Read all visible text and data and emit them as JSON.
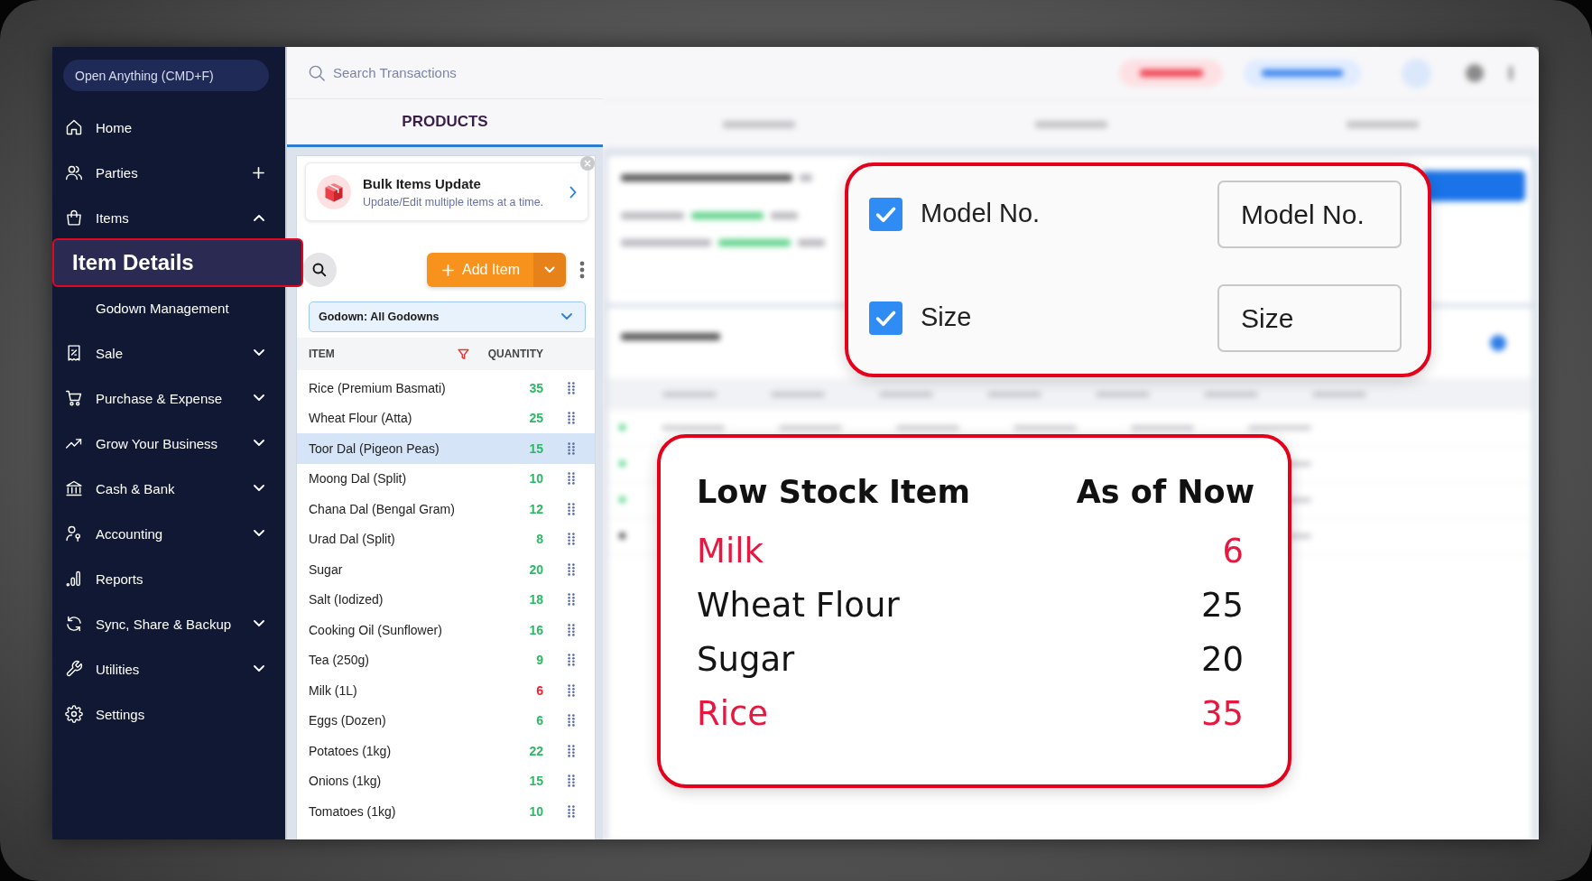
{
  "sidebar": {
    "search": {
      "placeholder": "Open Anything (CMD+F)"
    },
    "items": [
      {
        "kind": "link",
        "label": "Home"
      },
      {
        "kind": "add",
        "label": "Parties"
      },
      {
        "kind": "group",
        "label": "Items",
        "expanded": true,
        "children": [
          {
            "label": "Item Details",
            "selected": true
          },
          {
            "label": "Godown Management",
            "selected": false
          }
        ]
      },
      {
        "kind": "group",
        "label": "Sale",
        "expanded": false
      },
      {
        "kind": "group",
        "label": "Purchase & Expense",
        "expanded": false
      },
      {
        "kind": "group",
        "label": "Grow Your Business",
        "expanded": false
      },
      {
        "kind": "group",
        "label": "Cash & Bank",
        "expanded": false
      },
      {
        "kind": "group",
        "label": "Accounting",
        "expanded": false
      },
      {
        "kind": "link",
        "label": "Reports"
      },
      {
        "kind": "group",
        "label": "Sync, Share & Backup",
        "expanded": false
      },
      {
        "kind": "group",
        "label": "Utilities",
        "expanded": false
      },
      {
        "kind": "link",
        "label": "Settings"
      }
    ]
  },
  "products": {
    "search": {
      "placeholder": "Search Transactions"
    },
    "tabs": [
      {
        "label": "PRODUCTS",
        "selected": true
      }
    ],
    "banner": {
      "title": "Bulk Items Update",
      "subtitle": "Update/Edit multiple items at a time."
    },
    "add_button": {
      "label": "Add Item"
    },
    "godown_filter": {
      "value": "Godown: All Godowns"
    },
    "table": {
      "columns": [
        "ITEM",
        "QUANTITY"
      ],
      "rows": [
        {
          "item": "Rice (Premium Basmati)",
          "quantity": "35",
          "low_stock": false,
          "selected": false
        },
        {
          "item": "Wheat Flour (Atta)",
          "quantity": "25",
          "low_stock": false,
          "selected": false
        },
        {
          "item": "Toor Dal (Pigeon Peas)",
          "quantity": "15",
          "low_stock": false,
          "selected": true
        },
        {
          "item": "Moong Dal (Split)",
          "quantity": "10",
          "low_stock": false,
          "selected": false
        },
        {
          "item": "Chana Dal (Bengal Gram)",
          "quantity": "12",
          "low_stock": false,
          "selected": false
        },
        {
          "item": "Urad Dal (Split)",
          "quantity": "8",
          "low_stock": false,
          "selected": false
        },
        {
          "item": "Sugar",
          "quantity": "20",
          "low_stock": false,
          "selected": false
        },
        {
          "item": "Salt (Iodized)",
          "quantity": "18",
          "low_stock": false,
          "selected": false
        },
        {
          "item": "Cooking Oil (Sunflower)",
          "quantity": "16",
          "low_stock": false,
          "selected": false
        },
        {
          "item": "Tea (250g)",
          "quantity": "9",
          "low_stock": false,
          "selected": false
        },
        {
          "item": "Milk (1L)",
          "quantity": "6",
          "low_stock": true,
          "selected": false
        },
        {
          "item": "Eggs (Dozen)",
          "quantity": "6",
          "low_stock": false,
          "selected": false
        },
        {
          "item": "Potatoes (1kg)",
          "quantity": "22",
          "low_stock": false,
          "selected": false
        },
        {
          "item": "Onions (1kg)",
          "quantity": "15",
          "low_stock": false,
          "selected": false
        },
        {
          "item": "Tomatoes (1kg)",
          "quantity": "10",
          "low_stock": false,
          "selected": false
        }
      ]
    }
  },
  "custom_fields_callout": {
    "fields": [
      {
        "label": "Model No.",
        "checked": true,
        "value": "Model No."
      },
      {
        "label": "Size",
        "checked": true,
        "value": "Size"
      }
    ]
  },
  "low_stock_callout": {
    "columns": [
      "Low Stock Item",
      "As of Now"
    ],
    "rows": [
      {
        "item": "Milk",
        "quantity": "6",
        "highlighted": true
      },
      {
        "item": "Wheat Flour",
        "quantity": "25",
        "highlighted": false
      },
      {
        "item": "Sugar",
        "quantity": "20",
        "highlighted": false
      },
      {
        "item": "Rice",
        "quantity": "35",
        "highlighted": true
      }
    ]
  }
}
